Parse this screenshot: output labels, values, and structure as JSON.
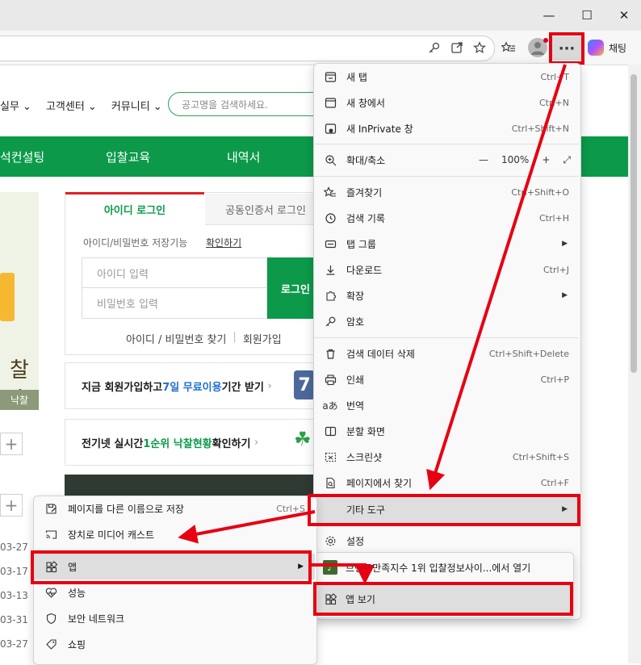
{
  "window": {
    "min_icon": "minimize-icon",
    "max_icon": "maximize-icon",
    "close_icon": "close-icon",
    "min_glyph": "—",
    "max_glyph": "☐",
    "close_glyph": "✕"
  },
  "toolbar": {
    "more_glyph": "···",
    "chat_label": "채팅"
  },
  "page": {
    "nav_top": [
      "실무",
      "고객센터",
      "커뮤니티"
    ],
    "search_placeholder": "공고명을 검색하세요.",
    "green_nav": [
      "석컨설팅",
      "입찰교육",
      "내역서"
    ],
    "banner_label": "낙찰",
    "banner_char": "찰人",
    "login": {
      "tab_id": "아이디 로그인",
      "tab_cert": "공동인증서 로그인",
      "save_text": "아이디/비밀번호 저장기능",
      "save_link": "확인하기",
      "id_placeholder": "아이디 입력",
      "pw_placeholder": "비밀번호 입력",
      "login_button": "로그인",
      "find_link": "아이디 / 비밀번호 찾기",
      "divider": "|",
      "join_link": "회원가입"
    },
    "promo1": {
      "a": "지금 회원가입하고 ",
      "b": "7일 무료이용",
      "c": " 기간 받기",
      "arrow": "›",
      "badge": "7"
    },
    "promo2": {
      "a": "전기넷 실시간 ",
      "b": "1순위 낙찰현황",
      "c": " 확인하기",
      "arrow": "›",
      "badge": "☘"
    },
    "plus": "+",
    "dates": [
      "03-27",
      "03-17",
      "03-13",
      "03-31",
      "03-27"
    ]
  },
  "menu": {
    "new_tab": {
      "label": "새 탭",
      "shortcut": "Ctrl+T"
    },
    "new_window": {
      "label": "새 창에서",
      "shortcut": "Ctrl+N"
    },
    "new_inprivate": {
      "label": "새 InPrivate 창",
      "shortcut": "Ctrl+Shift+N"
    },
    "zoom": {
      "label": "확대/축소",
      "minus": "—",
      "value": "100%",
      "plus": "+",
      "fullscreen": "⤢"
    },
    "favorites": {
      "label": "즐겨찾기",
      "shortcut": "Ctrl+Shift+O"
    },
    "history": {
      "label": "검색 기록",
      "shortcut": "Ctrl+H"
    },
    "tab_groups": {
      "label": "탭 그룹",
      "arrow": "▶"
    },
    "downloads": {
      "label": "다운로드",
      "shortcut": "Ctrl+J"
    },
    "extensions": {
      "label": "확장",
      "arrow": "▶"
    },
    "passwords": {
      "label": "암호"
    },
    "clear_data": {
      "label": "검색 데이터 삭제",
      "shortcut": "Ctrl+Shift+Delete"
    },
    "print": {
      "label": "인쇄",
      "shortcut": "Ctrl+P"
    },
    "translate": {
      "label": "번역"
    },
    "split_screen": {
      "label": "분할 화면"
    },
    "screenshot": {
      "label": "스크린샷",
      "shortcut": "Ctrl+Shift+S"
    },
    "find": {
      "label": "페이지에서 찾기",
      "shortcut": "Ctrl+F"
    },
    "more_tools": {
      "label": "기타 도구",
      "arrow": "▶"
    },
    "settings": {
      "label": "설정"
    }
  },
  "apps_menu": {
    "open_app": "브랜드만족지수 1위 입찰정보사이...에서 열기",
    "open_app_icon": "♪",
    "view_apps": "앱 보기"
  },
  "tools_menu": {
    "save_as": {
      "label": "페이지를 다른 이름으로 저장",
      "shortcut": "Ctrl+S"
    },
    "cast": {
      "label": "장치로 미디어 캐스트"
    },
    "apps": {
      "label": "앱",
      "arrow": "▶"
    },
    "performance": {
      "label": "성능"
    },
    "secure_network": {
      "label": "보안 네트워크"
    },
    "shopping": {
      "label": "쇼핑"
    }
  },
  "colors": {
    "accent_green": "#0c9a4a",
    "highlight_red": "#e60012",
    "menu_bg": "#f9f9f9"
  }
}
